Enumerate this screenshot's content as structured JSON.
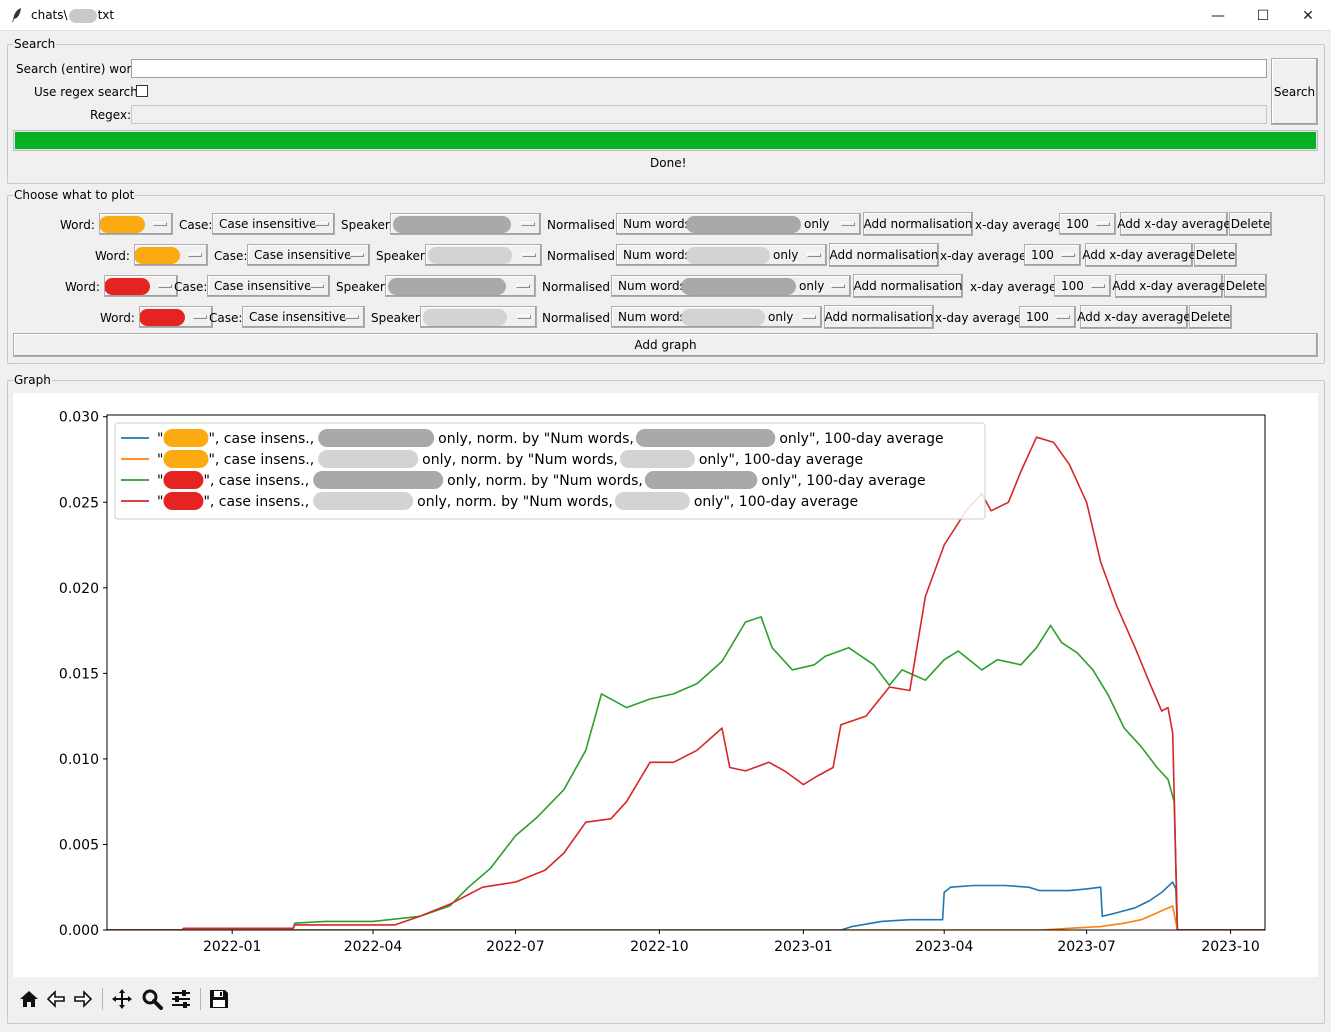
{
  "window": {
    "title_prefix": "chats\\",
    "title_suffix": "txt",
    "minimize_glyph": "—",
    "maximize_glyph": "☐",
    "close_glyph": "✕"
  },
  "search": {
    "group_label": "Search",
    "word_label": "Search (entire) word:",
    "word_value": "",
    "regex_toggle_label": "Use regex search:",
    "regex_checked": false,
    "regex_label": "Regex:",
    "regex_value": "",
    "search_button": "Search",
    "progress_fraction": 1.0,
    "status": "Done!"
  },
  "plot_config": {
    "group_label": "Choose what to plot",
    "rows": [
      {
        "word_label": "Word:",
        "word_color": "#fbaa12",
        "case_label": "Case:",
        "case_value": "Case insensitive",
        "speaker_label": "Speaker:",
        "normalised_label": "Normalised:",
        "normalised_prefix": "Num words,",
        "normalised_suffix": "only",
        "add_norm_button": "Add normalisation",
        "avg_label": "x-day average:",
        "avg_value": "100",
        "add_avg_button": "Add x-day average",
        "delete_button": "Delete"
      },
      {
        "word_label": "Word:",
        "word_color": "#fbaa12",
        "case_label": "Case:",
        "case_value": "Case insensitive",
        "speaker_label": "Speaker:",
        "normalised_label": "Normalised:",
        "normalised_prefix": "Num words,",
        "normalised_suffix": "only",
        "add_norm_button": "Add normalisation",
        "avg_label": "x-day average:",
        "avg_value": "100",
        "add_avg_button": "Add x-day average",
        "delete_button": "Delete"
      },
      {
        "word_label": "Word:",
        "word_color": "#e52421",
        "case_label": "Case:",
        "case_value": "Case insensitive",
        "speaker_label": "Speaker:",
        "normalised_label": "Normalised:",
        "normalised_prefix": "Num words,",
        "normalised_suffix": "only",
        "add_norm_button": "Add normalisation",
        "avg_label": "x-day average:",
        "avg_value": "100",
        "add_avg_button": "Add x-day average",
        "delete_button": "Delete"
      },
      {
        "word_label": "Word:",
        "word_color": "#e52421",
        "case_label": "Case:",
        "case_value": "Case insensitive",
        "speaker_label": "Speaker:",
        "normalised_label": "Normalised:",
        "normalised_prefix": "Num words,",
        "normalised_suffix": "only",
        "add_norm_button": "Add normalisation",
        "avg_label": "x-day average:",
        "avg_value": "100",
        "add_avg_button": "Add x-day average",
        "delete_button": "Delete"
      }
    ],
    "add_graph_button": "Add graph"
  },
  "graph_group_label": "Graph",
  "toolbar": {
    "icons": [
      "home-icon",
      "back-icon",
      "forward-icon",
      "pan-icon",
      "zoom-icon",
      "configure-subplots-icon",
      "save-icon"
    ]
  },
  "chart_data": {
    "type": "line",
    "title": "",
    "xlabel": "",
    "ylabel": "",
    "x_ticks": [
      "2022-01",
      "2022-04",
      "2022-07",
      "2022-10",
      "2023-01",
      "2023-04",
      "2023-07",
      "2023-10"
    ],
    "y_ticks": [
      "0.000",
      "0.005",
      "0.010",
      "0.015",
      "0.020",
      "0.025",
      "0.030"
    ],
    "xlim": [
      "2021-10-13",
      "2023-10-23"
    ],
    "ylim": [
      0.0,
      0.0301
    ],
    "grid": false,
    "legend_position": "upper-left",
    "series": [
      {
        "color": "#1f77b4",
        "legend_text": [
          "\"",
          "\", case insens.,",
          " only, norm. by \"Num words,",
          " only\", 100-day average"
        ],
        "word_color": "#fbaa12",
        "points": [
          [
            "2021-10-13",
            0.0
          ],
          [
            "2023-01-25",
            0.0
          ],
          [
            "2023-02-01",
            0.0002
          ],
          [
            "2023-02-20",
            0.0005
          ],
          [
            "2023-03-10",
            0.0006
          ],
          [
            "2023-03-31",
            0.0006
          ],
          [
            "2023-04-01",
            0.0022
          ],
          [
            "2023-04-05",
            0.0025
          ],
          [
            "2023-04-20",
            0.0026
          ],
          [
            "2023-05-10",
            0.0026
          ],
          [
            "2023-05-25",
            0.0025
          ],
          [
            "2023-06-01",
            0.0023
          ],
          [
            "2023-06-20",
            0.0023
          ],
          [
            "2023-07-01",
            0.0024
          ],
          [
            "2023-07-10",
            0.0025
          ],
          [
            "2023-07-11",
            0.0008
          ],
          [
            "2023-07-20",
            0.001
          ],
          [
            "2023-08-01",
            0.0013
          ],
          [
            "2023-08-10",
            0.0017
          ],
          [
            "2023-08-18",
            0.0022
          ],
          [
            "2023-08-25",
            0.0028
          ],
          [
            "2023-08-27",
            0.0024
          ],
          [
            "2023-08-28",
            0.0
          ],
          [
            "2023-10-23",
            0.0
          ]
        ]
      },
      {
        "color": "#ff7f0e",
        "legend_text": [
          "\"",
          "\", case insens.,",
          "only, norm. by \"Num words,",
          "only\", 100-day average"
        ],
        "word_color": "#fbaa12",
        "points": [
          [
            "2021-10-13",
            0.0
          ],
          [
            "2023-06-01",
            0.0
          ],
          [
            "2023-06-20",
            0.0001
          ],
          [
            "2023-07-10",
            0.0002
          ],
          [
            "2023-07-25",
            0.0004
          ],
          [
            "2023-08-05",
            0.0006
          ],
          [
            "2023-08-15",
            0.001
          ],
          [
            "2023-08-25",
            0.0014
          ],
          [
            "2023-08-28",
            0.0
          ],
          [
            "2023-10-23",
            0.0
          ]
        ]
      },
      {
        "color": "#2ca02c",
        "legend_text": [
          "\"",
          "\", case insens.,",
          " only, norm. by \"Num words,",
          " only\", 100-day average"
        ],
        "word_color": "#e52421",
        "points": [
          [
            "2021-10-13",
            0.0
          ],
          [
            "2021-11-30",
            0.0
          ],
          [
            "2021-12-01",
            0.0001
          ],
          [
            "2022-02-09",
            0.0001
          ],
          [
            "2022-02-10",
            0.0004
          ],
          [
            "2022-03-01",
            0.0005
          ],
          [
            "2022-04-01",
            0.0005
          ],
          [
            "2022-05-01",
            0.0008
          ],
          [
            "2022-05-20",
            0.0014
          ],
          [
            "2022-06-01",
            0.0025
          ],
          [
            "2022-06-15",
            0.0036
          ],
          [
            "2022-07-01",
            0.0055
          ],
          [
            "2022-07-15",
            0.0066
          ],
          [
            "2022-08-01",
            0.0082
          ],
          [
            "2022-08-15",
            0.0105
          ],
          [
            "2022-08-25",
            0.0138
          ],
          [
            "2022-09-10",
            0.013
          ],
          [
            "2022-09-25",
            0.0135
          ],
          [
            "2022-10-10",
            0.0138
          ],
          [
            "2022-10-25",
            0.0144
          ],
          [
            "2022-11-10",
            0.0157
          ],
          [
            "2022-11-25",
            0.018
          ],
          [
            "2022-12-05",
            0.0183
          ],
          [
            "2022-12-12",
            0.0165
          ],
          [
            "2022-12-25",
            0.0152
          ],
          [
            "2023-01-08",
            0.0155
          ],
          [
            "2023-01-15",
            0.016
          ],
          [
            "2023-01-30",
            0.0165
          ],
          [
            "2023-02-15",
            0.0155
          ],
          [
            "2023-02-25",
            0.0143
          ],
          [
            "2023-03-05",
            0.0152
          ],
          [
            "2023-03-20",
            0.0146
          ],
          [
            "2023-04-01",
            0.0158
          ],
          [
            "2023-04-10",
            0.0163
          ],
          [
            "2023-04-25",
            0.0152
          ],
          [
            "2023-05-05",
            0.0158
          ],
          [
            "2023-05-20",
            0.0155
          ],
          [
            "2023-05-30",
            0.0165
          ],
          [
            "2023-06-08",
            0.0178
          ],
          [
            "2023-06-15",
            0.0168
          ],
          [
            "2023-06-25",
            0.0162
          ],
          [
            "2023-07-05",
            0.0152
          ],
          [
            "2023-07-15",
            0.0137
          ],
          [
            "2023-07-25",
            0.0118
          ],
          [
            "2023-08-05",
            0.0107
          ],
          [
            "2023-08-15",
            0.0095
          ],
          [
            "2023-08-22",
            0.0088
          ],
          [
            "2023-08-26",
            0.0075
          ],
          [
            "2023-08-28",
            0.0
          ],
          [
            "2023-10-23",
            0.0
          ]
        ]
      },
      {
        "color": "#d62728",
        "legend_text": [
          "\"",
          "\", case insens.,",
          "only, norm. by \"Num words,",
          "only\", 100-day average"
        ],
        "word_color": "#e52421",
        "points": [
          [
            "2021-10-13",
            0.0
          ],
          [
            "2021-11-30",
            0.0
          ],
          [
            "2021-12-01",
            0.0001
          ],
          [
            "2022-02-09",
            0.0001
          ],
          [
            "2022-02-10",
            0.0003
          ],
          [
            "2022-04-15",
            0.0003
          ],
          [
            "2022-05-01",
            0.0008
          ],
          [
            "2022-05-20",
            0.0015
          ],
          [
            "2022-06-10",
            0.0025
          ],
          [
            "2022-07-01",
            0.0028
          ],
          [
            "2022-07-20",
            0.0035
          ],
          [
            "2022-08-01",
            0.0045
          ],
          [
            "2022-08-15",
            0.0063
          ],
          [
            "2022-08-31",
            0.0065
          ],
          [
            "2022-09-10",
            0.0075
          ],
          [
            "2022-09-25",
            0.0098
          ],
          [
            "2022-10-10",
            0.0098
          ],
          [
            "2022-10-25",
            0.0105
          ],
          [
            "2022-11-10",
            0.0118
          ],
          [
            "2022-11-15",
            0.0095
          ],
          [
            "2022-11-25",
            0.0093
          ],
          [
            "2022-12-10",
            0.0098
          ],
          [
            "2022-12-20",
            0.0093
          ],
          [
            "2023-01-01",
            0.0085
          ],
          [
            "2023-01-10",
            0.009
          ],
          [
            "2023-01-20",
            0.0095
          ],
          [
            "2023-01-25",
            0.012
          ],
          [
            "2023-02-10",
            0.0125
          ],
          [
            "2023-02-25",
            0.0142
          ],
          [
            "2023-03-10",
            0.014
          ],
          [
            "2023-03-20",
            0.0195
          ],
          [
            "2023-04-01",
            0.0225
          ],
          [
            "2023-04-15",
            0.0245
          ],
          [
            "2023-04-25",
            0.0255
          ],
          [
            "2023-05-01",
            0.0245
          ],
          [
            "2023-05-12",
            0.025
          ],
          [
            "2023-05-20",
            0.0268
          ],
          [
            "2023-05-30",
            0.0288
          ],
          [
            "2023-06-10",
            0.0285
          ],
          [
            "2023-06-20",
            0.0272
          ],
          [
            "2023-07-01",
            0.025
          ],
          [
            "2023-07-10",
            0.0215
          ],
          [
            "2023-07-20",
            0.019
          ],
          [
            "2023-08-01",
            0.0165
          ],
          [
            "2023-08-10",
            0.0145
          ],
          [
            "2023-08-18",
            0.0128
          ],
          [
            "2023-08-22",
            0.013
          ],
          [
            "2023-08-25",
            0.0115
          ],
          [
            "2023-08-28",
            0.0
          ],
          [
            "2023-10-23",
            0.0
          ]
        ]
      }
    ]
  }
}
